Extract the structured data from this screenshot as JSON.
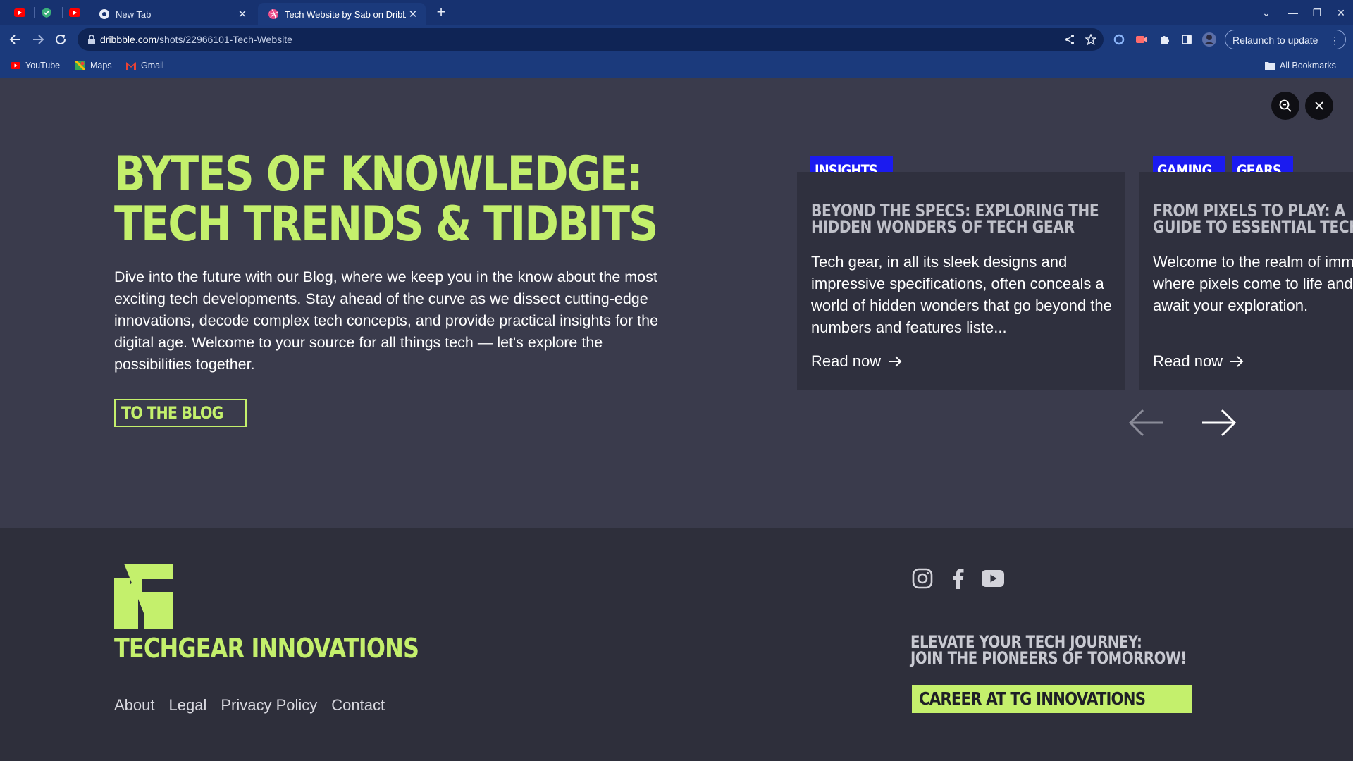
{
  "browser": {
    "tabs": [
      {
        "title": "New Tab"
      },
      {
        "title": "Tech Website by Sab on Dribbble"
      }
    ],
    "new_tab_symbol": "+",
    "url_host": "dribbble.com",
    "url_path": "/shots/22966101-Tech-Website",
    "relaunch_label": "Relaunch to update",
    "bookmarks": [
      "YouTube",
      "Maps",
      "Gmail"
    ],
    "all_bookmarks": "All Bookmarks"
  },
  "hero": {
    "title_line1": "BYTES OF KNOWLEDGE:",
    "title_line2": "TECH TRENDS & TIDBITS",
    "description": "Dive into the future with our Blog, where we keep you in the know about the most exciting tech developments. Stay ahead of the curve as we dissect cutting-edge innovations, decode complex tech concepts, and provide practical insights for the digital age. Welcome to your source for all things tech — let's explore the possibilities together.",
    "cta_label": "TO THE BLOG"
  },
  "cards": [
    {
      "tags": [
        "INSIGHTS"
      ],
      "title_line1": "BEYOND THE SPECS: EXPLORING THE",
      "title_line2": "HIDDEN WONDERS OF TECH GEAR",
      "text": "Tech gear, in all its sleek designs and impressive specifications, often conceals a world of hidden wonders that go beyond the numbers and features liste...",
      "link": "Read now"
    },
    {
      "tags": [
        "GAMING",
        "GEARS"
      ],
      "title_line1": "FROM PIXELS TO PLAY: A",
      "title_line2": "GUIDE TO ESSENTIAL TECH",
      "text": "Welcome to the realm of immersive gaming, where pixels come to life and virtual worlds await your exploration.",
      "link": "Read now"
    }
  ],
  "footer": {
    "brand": "TECHGEAR INNOVATIONS",
    "links": [
      "About",
      "Legal",
      "Privacy Policy",
      "Contact"
    ],
    "tagline_line1": "ELEVATE YOUR TECH JOURNEY:",
    "tagline_line2": "JOIN THE PIONEERS OF TOMORROW!",
    "career_label": "CAREER AT TG INNOVATIONS",
    "social_icons": [
      "instagram-icon",
      "facebook-icon",
      "youtube-icon"
    ]
  },
  "colors": {
    "accent": "#c4f06c",
    "tag_blue": "#1b1bf0",
    "hero_bg": "#3a3b4c",
    "footer_bg": "#2e2f3b",
    "chrome_bg": "#1b3a7c"
  }
}
